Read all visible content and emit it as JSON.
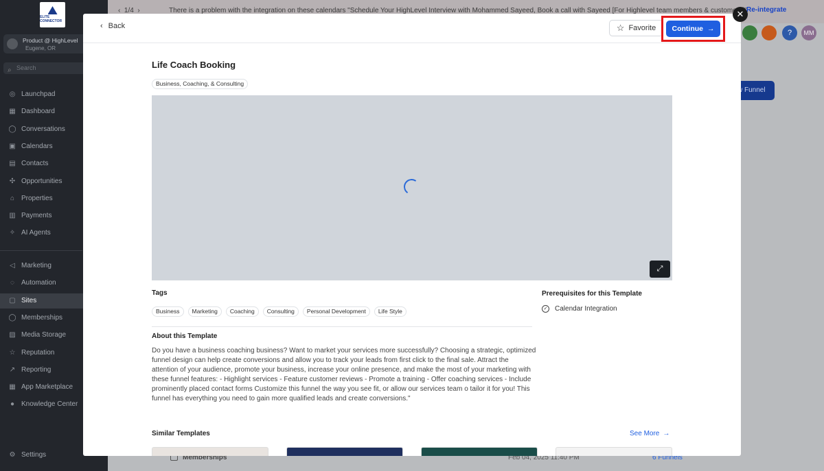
{
  "sidebar": {
    "logo_text": "ELITE CONNECTOR",
    "account_name": "Product @ HighLevel",
    "account_location": "Eugene, OR",
    "search_placeholder": "Search",
    "search_shortcut": "⌘K",
    "items_top": [
      {
        "icon": "rocket-icon",
        "glyph": "◎",
        "label": "Launchpad"
      },
      {
        "icon": "dashboard-icon",
        "glyph": "▦",
        "label": "Dashboard"
      },
      {
        "icon": "chat-icon",
        "glyph": "◯",
        "label": "Conversations"
      },
      {
        "icon": "calendar-icon",
        "glyph": "▣",
        "label": "Calendars"
      },
      {
        "icon": "contacts-icon",
        "glyph": "▤",
        "label": "Contacts"
      },
      {
        "icon": "opportunities-icon",
        "glyph": "✣",
        "label": "Opportunities"
      },
      {
        "icon": "home-icon",
        "glyph": "⌂",
        "label": "Properties"
      },
      {
        "icon": "payments-icon",
        "glyph": "▥",
        "label": "Payments"
      },
      {
        "icon": "sparkle-icon",
        "glyph": "✧",
        "label": "AI Agents"
      }
    ],
    "items_bottom": [
      {
        "icon": "megaphone-icon",
        "glyph": "◁",
        "label": "Marketing"
      },
      {
        "icon": "automation-icon",
        "glyph": "◌",
        "label": "Automation"
      },
      {
        "icon": "sites-icon",
        "glyph": "▢",
        "label": "Sites",
        "active": true
      },
      {
        "icon": "memberships-icon",
        "glyph": "◯",
        "label": "Memberships"
      },
      {
        "icon": "media-icon",
        "glyph": "▨",
        "label": "Media Storage"
      },
      {
        "icon": "star-icon",
        "glyph": "☆",
        "label": "Reputation"
      },
      {
        "icon": "chart-icon",
        "glyph": "↗",
        "label": "Reporting"
      },
      {
        "icon": "apps-icon",
        "glyph": "▦",
        "label": "App Marketplace"
      },
      {
        "icon": "info-icon",
        "glyph": "●",
        "label": "Knowledge Center"
      }
    ],
    "settings_label": "Settings"
  },
  "topbar": {
    "pager": "1/4",
    "notice": "There is a problem with the integration on these calendars \"Schedule Your HighLevel Interview with Mohammed Sayeed, Book a call with Sayeed [For Highlevel team members & customers]\"",
    "action": "Re-integrate",
    "avatar_initials": "MM",
    "help_glyph": "?"
  },
  "background": {
    "new_funnel_label": "w Funnel",
    "row_name": "Memberships",
    "row_date": "Feb 04, 2025 11:40 PM",
    "row_count": "6 Funnels"
  },
  "modal": {
    "back_label": "Back",
    "favorite_label": "Favorite",
    "continue_label": "Continue",
    "title": "Life Coach Booking",
    "category": "Business, Coaching, & Consulting",
    "tags_heading": "Tags",
    "tags": [
      "Business",
      "Marketing",
      "Coaching",
      "Consulting",
      "Personal Development",
      "Life Style"
    ],
    "prereq_heading": "Prerequisites for this Template",
    "prereq_item": "Calendar Integration",
    "about_heading": "About this Template",
    "about_text": "Do you have a business coaching business? Want to market your services more successfully? Choosing a strategic, optimized funnel design can help create conversions and allow you to track your leads from first click to the final sale. Attract the attention of your audience, promote your business, increase your online presence, and make the most of your marketing with these funnel features: - Highlight services - Feature customer reviews - Promote a training - Offer coaching services - Include prominently placed contact forms Customize this funnel the way you see fit, or allow our services team o tailor it for you! This funnel has everything you need to gain more qualified leads and create conversions.\"",
    "similar_heading": "Similar Templates",
    "see_more_label": "See More",
    "thumb_colors": [
      "#e9e4e0",
      "#1f2f5e",
      "#1a4d49",
      "#f3f3f3"
    ]
  },
  "colors": {
    "primary": "#1f5fe0",
    "highlight_border": "#e4181a",
    "sidebar_bg": "#23262c"
  }
}
